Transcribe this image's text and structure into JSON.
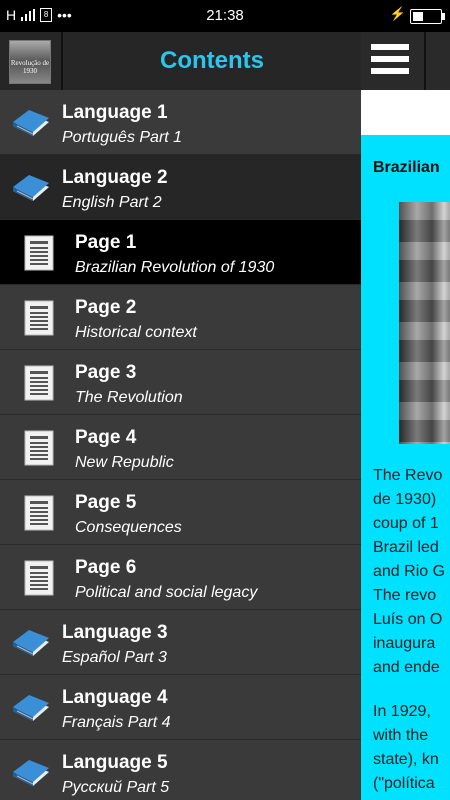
{
  "status": {
    "carrier": "H",
    "sim": "8",
    "dots": "•••",
    "time": "21:38",
    "charging": "⚡"
  },
  "drawer": {
    "title": "Contents",
    "logo_text": "Revolução de 1930",
    "items": [
      {
        "type": "lang",
        "title": "Language 1",
        "subtitle": "Português Part 1"
      },
      {
        "type": "lang",
        "title": "Language 2",
        "subtitle": "English Part 2"
      },
      {
        "type": "page",
        "title": "Page 1",
        "subtitle": "Brazilian Revolution of 1930"
      },
      {
        "type": "page",
        "title": "Page 2",
        "subtitle": "Historical context"
      },
      {
        "type": "page",
        "title": "Page 3",
        "subtitle": "The Revolution"
      },
      {
        "type": "page",
        "title": "Page 4",
        "subtitle": "New Republic"
      },
      {
        "type": "page",
        "title": "Page 5",
        "subtitle": "Consequences"
      },
      {
        "type": "page",
        "title": "Page 6",
        "subtitle": "Political and social legacy"
      },
      {
        "type": "lang",
        "title": "Language 3",
        "subtitle": "Español Part 3"
      },
      {
        "type": "lang",
        "title": "Language 4",
        "subtitle": "Français Part 4"
      },
      {
        "type": "lang",
        "title": "Language 5",
        "subtitle": "Русский Part 5"
      }
    ]
  },
  "content": {
    "title": "Brazilian",
    "para1": [
      "The Revo",
      "de 1930)",
      "coup of 1",
      "Brazil led",
      "and Rio G",
      "The revo",
      "Luís on O",
      "inaugura",
      "and ende"
    ],
    "para2": [
      "In 1929, ",
      "with the ",
      "state), kn",
      "(\"política",
      "   "
    ]
  },
  "colors": {
    "accent": "#29c7f0",
    "content_bg": "#00e0ff"
  }
}
